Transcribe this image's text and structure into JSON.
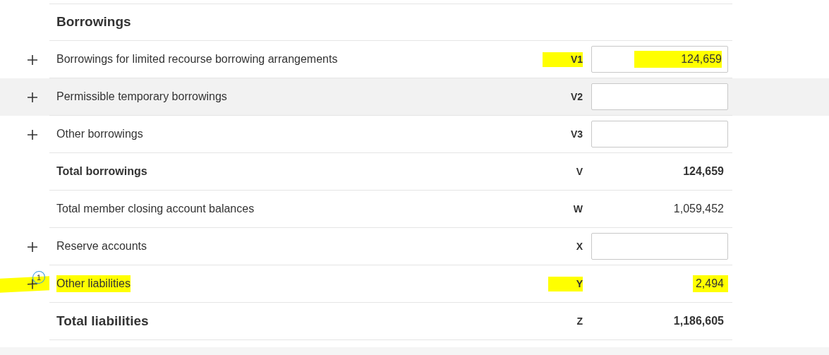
{
  "heading": "Borrowings",
  "rows": [
    {
      "kind": "input",
      "expandable": true,
      "hovered": false,
      "label": "Borrowings for limited recourse borrowing arrangements",
      "code": "V1",
      "value": "124,659",
      "highlight_code": true,
      "highlight_value": true
    },
    {
      "kind": "input",
      "expandable": true,
      "hovered": true,
      "label": "Permissible temporary borrowings",
      "code": "V2"
    },
    {
      "kind": "input",
      "expandable": true,
      "hovered": false,
      "label": "Other borrowings",
      "code": "V3"
    },
    {
      "kind": "subtotal",
      "expandable": false,
      "hovered": false,
      "label": "Total borrowings",
      "code": "V",
      "value": "124,659"
    },
    {
      "kind": "plain",
      "expandable": false,
      "hovered": false,
      "label": "Total member closing account balances",
      "code": "W",
      "value": "1,059,452"
    },
    {
      "kind": "input",
      "expandable": true,
      "hovered": false,
      "label": "Reserve accounts",
      "code": "X"
    },
    {
      "kind": "plain",
      "expandable": true,
      "hovered": false,
      "label": "Other liabilities",
      "code": "Y",
      "value": "2,494",
      "badge": "1",
      "highlight_code": true,
      "highlight_value": true,
      "highlight_label": true
    },
    {
      "kind": "total",
      "expandable": false,
      "hovered": false,
      "label": "Total liabilities",
      "code": "Z",
      "value": "1,186,605"
    }
  ]
}
